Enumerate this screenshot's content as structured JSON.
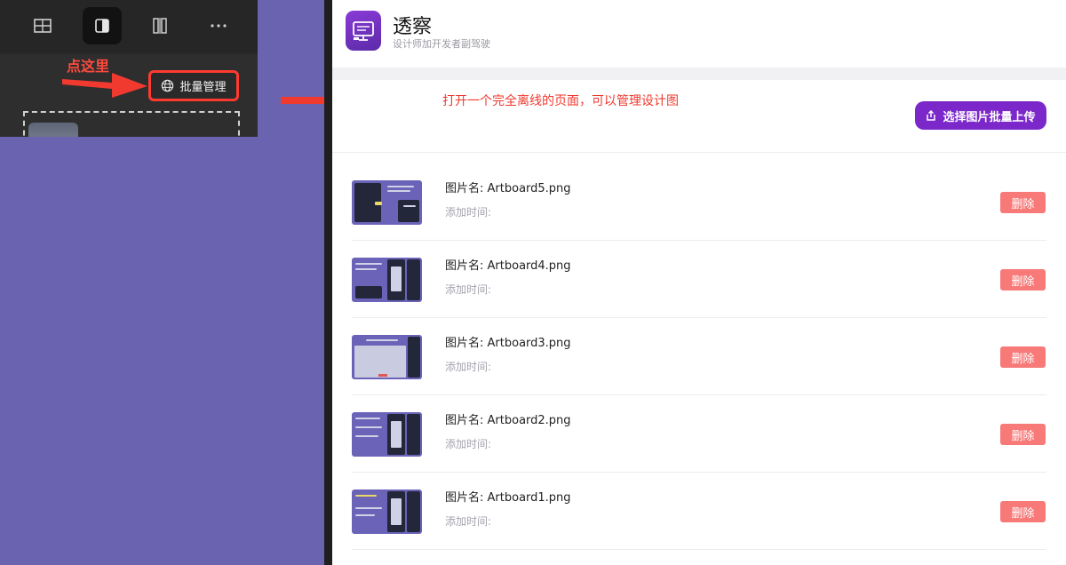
{
  "left_panel": {
    "annotation": "点这里",
    "batch_button": "批量管理",
    "toolbar": [
      "grid-icon",
      "panel-icon",
      "split-icon",
      "more-icon"
    ]
  },
  "app": {
    "title": "透察",
    "subtitle": "设计师加开发者副驾驶",
    "hint": "打开一个完全离线的页面，可以管理设计图",
    "upload_button": "选择图片批量上传",
    "accent": "#7b27c9",
    "danger": "#f77a78",
    "items": [
      {
        "name_label": "图片名:",
        "name": "Artboard5.png",
        "time_label": "添加时间:",
        "delete": "删除"
      },
      {
        "name_label": "图片名:",
        "name": "Artboard4.png",
        "time_label": "添加时间:",
        "delete": "删除"
      },
      {
        "name_label": "图片名:",
        "name": "Artboard3.png",
        "time_label": "添加时间:",
        "delete": "删除"
      },
      {
        "name_label": "图片名:",
        "name": "Artboard2.png",
        "time_label": "添加时间:",
        "delete": "删除"
      },
      {
        "name_label": "图片名:",
        "name": "Artboard1.png",
        "time_label": "添加时间:",
        "delete": "删除"
      }
    ]
  }
}
